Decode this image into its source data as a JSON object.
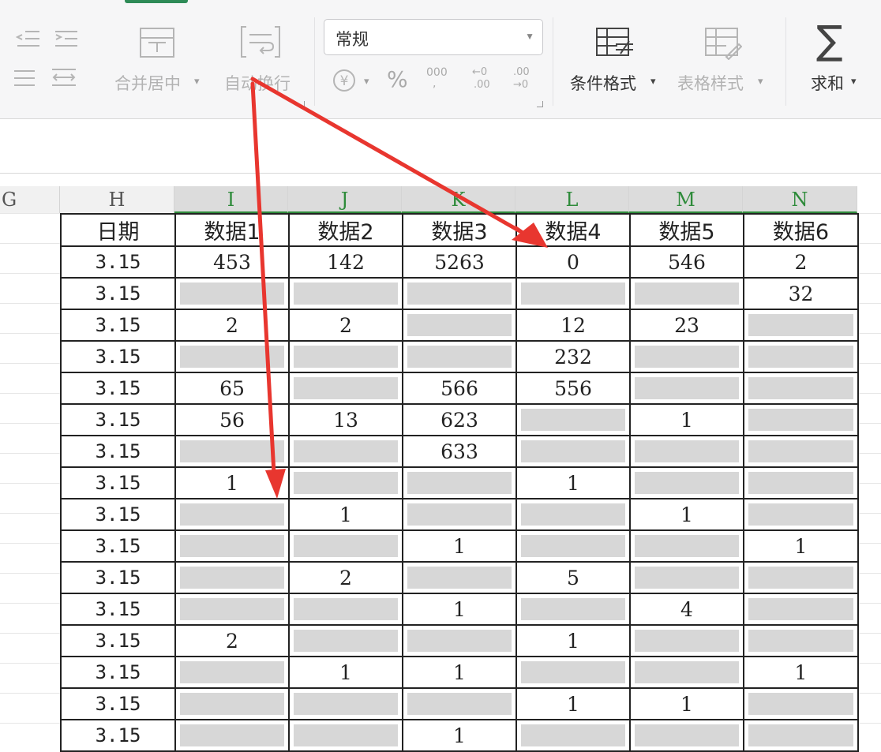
{
  "ribbon": {
    "merge_center_label": "合并居中",
    "wrap_text_label": "自动换行",
    "number_format_value": "常规",
    "currency_symbol": "¥",
    "percent_symbol": "%",
    "thousands_symbol": "000",
    "increase_decimal_top": "←0",
    "increase_decimal_bottom": ".00",
    "decrease_decimal_top": ".00",
    "decrease_decimal_bottom": "→0",
    "conditional_format_label": "条件格式",
    "table_style_label": "表格样式",
    "sum_label": "求和",
    "sum_symbol": "∑"
  },
  "column_headers": [
    "G",
    "H",
    "I",
    "J",
    "K",
    "L",
    "M",
    "N"
  ],
  "table": {
    "header": [
      "日期",
      "数据1",
      "数据2",
      "数据3",
      "数据4",
      "数据5",
      "数据6"
    ],
    "rows": [
      [
        "3.15",
        "453",
        "142",
        "5263",
        "0",
        "546",
        "2"
      ],
      [
        "3.15",
        "",
        "",
        "",
        "",
        "",
        "32"
      ],
      [
        "3.15",
        "2",
        "2",
        "",
        "12",
        "23",
        ""
      ],
      [
        "3.15",
        "",
        "",
        "",
        "232",
        "",
        ""
      ],
      [
        "3.15",
        "65",
        "",
        "566",
        "556",
        "",
        ""
      ],
      [
        "3.15",
        "56",
        "13",
        "623",
        "",
        "1",
        ""
      ],
      [
        "3.15",
        "",
        "",
        "633",
        "",
        "",
        ""
      ],
      [
        "3.15",
        "1",
        "",
        "",
        "1",
        "",
        ""
      ],
      [
        "3.15",
        "",
        "1",
        "",
        "",
        "1",
        ""
      ],
      [
        "3.15",
        "",
        "",
        "1",
        "",
        "",
        "1"
      ],
      [
        "3.15",
        "",
        "2",
        "",
        "5",
        "",
        ""
      ],
      [
        "3.15",
        "",
        "",
        "1",
        "",
        "4",
        ""
      ],
      [
        "3.15",
        "2",
        "",
        "",
        "1",
        "",
        ""
      ],
      [
        "3.15",
        "",
        "1",
        "1",
        "",
        "",
        "1"
      ],
      [
        "3.15",
        "",
        "",
        "",
        "1",
        "1",
        ""
      ],
      [
        "3.15",
        "",
        "",
        "1",
        "",
        "",
        ""
      ]
    ]
  },
  "colors": {
    "arrow": "#e8362f",
    "selected_header_text": "#2e8b3a",
    "empty_cell_fill": "#d7d7d7"
  }
}
